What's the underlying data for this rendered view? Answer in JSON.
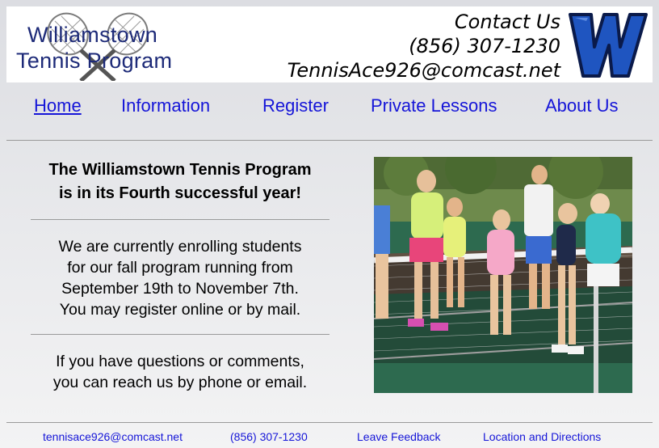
{
  "header": {
    "logo_line1": "Williamstown",
    "logo_line2": "Tennis Program",
    "contact_title": "Contact Us",
    "phone": "(856) 307-1230",
    "email": "TennisAce926@comcast.net",
    "brand_color": "#1d2a78",
    "w_logo_color": "#1f55c0"
  },
  "nav": {
    "items": [
      {
        "label": "Home",
        "active": true
      },
      {
        "label": "Information"
      },
      {
        "label": "Register"
      },
      {
        "label": "Private Lessons"
      },
      {
        "label": "About Us"
      }
    ],
    "link_color": "#1515d8"
  },
  "main": {
    "headline_line1": "The Williamstown Tennis Program",
    "headline_line2": "is in its Fourth successful year!",
    "para1": [
      "We are currently enrolling students",
      "for our fall program running from",
      "September 19th to November 7th.",
      "You may register online or by mail."
    ],
    "para2": [
      "If you have questions or comments,",
      "you can reach us by phone or email."
    ]
  },
  "footer": {
    "email": "tennisace926@comcast.net",
    "phone": "(856) 307-1230",
    "feedback": "Leave Feedback",
    "directions": "Location and Directions"
  }
}
